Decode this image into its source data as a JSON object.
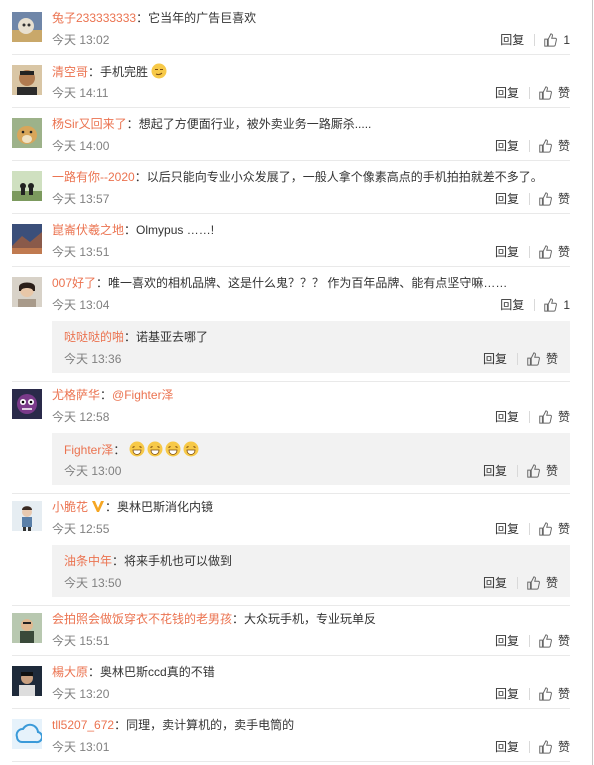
{
  "actions": {
    "reply_label": "回复",
    "like_label": "赞"
  },
  "colors": {
    "username": "#eb7350",
    "time": "#808080",
    "subreply_bg": "#f2f2f2"
  },
  "comments": [
    {
      "user": "兔子233333333",
      "text": "它当年的广告巨喜欢",
      "time": "今天 13:02",
      "like": "1"
    },
    {
      "user": "清空哥",
      "text": "手机完胜",
      "emoji": "smirk-emoji",
      "time": "今天 14:11",
      "like": "赞"
    },
    {
      "user": "杨Sir又回来了",
      "text": "想起了方便面行业，被外卖业务一路厮杀.....",
      "time": "今天 14:00",
      "like": "赞"
    },
    {
      "user": "一路有你--2020",
      "text": "以后只能向专业小众发展了，一般人拿个像素高点的手机拍拍就差不多了。",
      "time": "今天 13:57",
      "like": "赞"
    },
    {
      "user": "崑崙伏羲之地",
      "text": "Olmypus ……!",
      "time": "今天 13:51",
      "like": "赞"
    },
    {
      "user": "007好了",
      "text": "唯一喜欢的相机品牌、这是什么鬼？？？ 作为百年品牌、能有点坚守嘛……",
      "time": "今天 13:04",
      "like": "1",
      "reply": {
        "user": "哒哒哒的啪",
        "text": "诺基亚去哪了",
        "time": "今天 13:36",
        "like": "赞"
      }
    },
    {
      "user": "尤格萨华",
      "text": "@Fighter泽",
      "mention": true,
      "time": "今天 12:58",
      "like": "赞",
      "reply": {
        "user": "Fighter泽",
        "text": "",
        "emoji_count": 4,
        "emoji": "laughing-emoji",
        "time": "今天 13:00",
        "like": "赞"
      }
    },
    {
      "user": "小脆花",
      "vip": true,
      "text": "奥林巴斯消化内镜",
      "time": "今天 12:55",
      "like": "赞",
      "reply": {
        "user": "油条中年",
        "text": "将来手机也可以做到",
        "time": "今天 13:50",
        "like": "赞"
      }
    },
    {
      "user": "会拍照会做饭穿衣不花钱的老男孩",
      "text": "大众玩手机，专业玩单反",
      "time": "今天 15:51",
      "like": "赞"
    },
    {
      "user": "楊大原",
      "text": "奥林巴斯ccd真的不错",
      "time": "今天 13:20",
      "like": "赞"
    },
    {
      "user": "tll5207_672",
      "text": "同理，卖计算机的，卖手电筒的",
      "time": "今天 13:01",
      "like": "赞"
    }
  ]
}
